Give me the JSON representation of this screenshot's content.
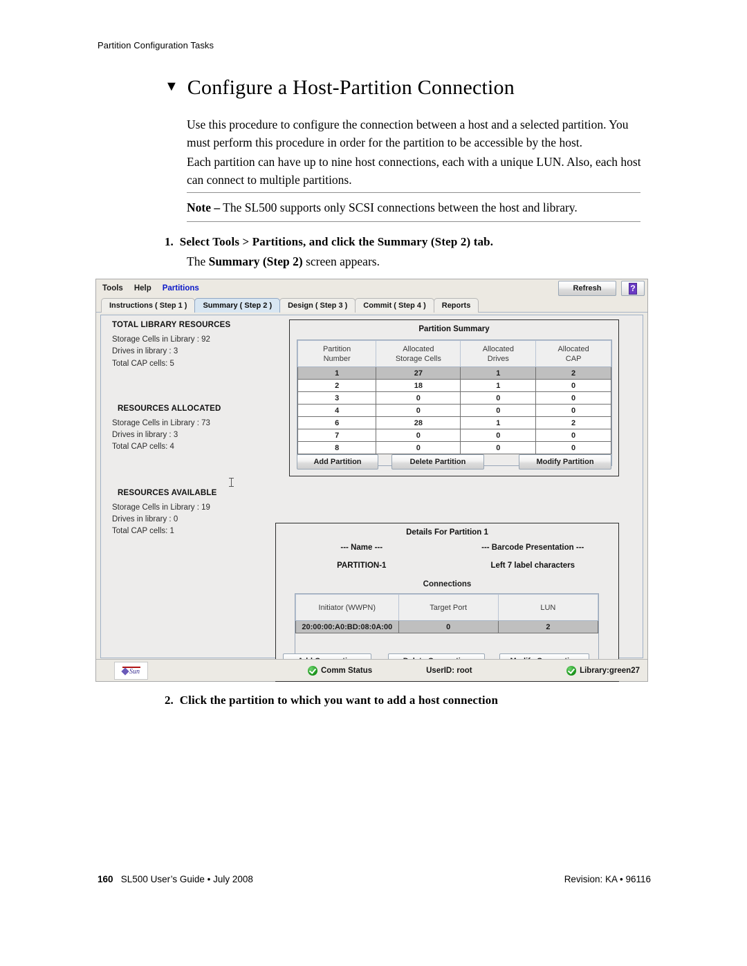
{
  "page": {
    "running_head": "Partition Configuration Tasks",
    "heading": "Configure a Host-Partition Connection",
    "heading_marker": "▼",
    "paragraph_1": "Use this procedure to configure the connection between a host and a selected partition. You must perform this procedure in order for the partition to be accessible by the host.",
    "paragraph_2": "Each partition can have up to nine host connections, each with a unique LUN. Also, each host can connect to multiple partitions.",
    "note_label": "Note –",
    "note_text": "The SL500 supports only SCSI connections between the host and library.",
    "step_1_number": "1.",
    "step_1_text": "Select Tools > Partitions, and click the Summary (Step 2) tab.",
    "step_1_sub_prefix": "The ",
    "step_1_sub_bold": "Summary (Step 2)",
    "step_1_sub_suffix": " screen appears.",
    "step_2_number": "2.",
    "step_2_text": "Click the partition to which you want to add a host connection",
    "footer_page": "160",
    "footer_left": "SL500 User’s Guide • July 2008",
    "footer_right": "Revision: KA • 96116"
  },
  "app": {
    "menubar": {
      "items": [
        {
          "label": "Tools",
          "active": false
        },
        {
          "label": "Help",
          "active": false
        },
        {
          "label": "Partitions",
          "active": true
        }
      ],
      "refresh_label": "Refresh",
      "help_label": "?"
    },
    "tabs": [
      {
        "label": "Instructions ( Step 1 )",
        "selected": false
      },
      {
        "label": "Summary ( Step 2 )",
        "selected": true
      },
      {
        "label": "Design ( Step 3 )",
        "selected": false
      },
      {
        "label": "Commit ( Step 4 )",
        "selected": false
      },
      {
        "label": "Reports",
        "selected": false
      }
    ],
    "resources": [
      {
        "heading": "TOTAL LIBRARY RESOURCES",
        "lines": [
          "Storage Cells in Library : 92",
          "Drives in library : 3",
          "Total CAP cells: 5"
        ]
      },
      {
        "heading": "RESOURCES ALLOCATED",
        "lines": [
          "Storage Cells in Library : 73",
          "Drives in library : 3",
          "Total CAP cells: 4"
        ]
      },
      {
        "heading": "RESOURCES AVAILABLE",
        "lines": [
          "Storage Cells in Library : 19",
          "Drives in library : 0",
          "Total CAP cells: 1"
        ]
      }
    ],
    "summary": {
      "title": "Partition Summary",
      "columns": [
        "Partition\nNumber",
        "Allocated\nStorage Cells",
        "Allocated\nDrives",
        "Allocated\nCAP"
      ],
      "rows": [
        {
          "cells": [
            "1",
            "27",
            "1",
            "2"
          ],
          "selected": true
        },
        {
          "cells": [
            "2",
            "18",
            "1",
            "0"
          ],
          "selected": false
        },
        {
          "cells": [
            "3",
            "0",
            "0",
            "0"
          ],
          "selected": false
        },
        {
          "cells": [
            "4",
            "0",
            "0",
            "0"
          ],
          "selected": false
        },
        {
          "cells": [
            "6",
            "28",
            "1",
            "2"
          ],
          "selected": false
        },
        {
          "cells": [
            "7",
            "0",
            "0",
            "0"
          ],
          "selected": false
        },
        {
          "cells": [
            "8",
            "0",
            "0",
            "0"
          ],
          "selected": false
        }
      ],
      "buttons": {
        "add": "Add Partition",
        "delete": "Delete Partition",
        "modify": "Modify Partition"
      }
    },
    "details": {
      "title": "Details For Partition 1",
      "name_label": "--- Name ---",
      "name_value": "PARTITION-1",
      "barcode_label": "--- Barcode Presentation ---",
      "barcode_value": "Left 7 label characters",
      "connections_title": "Connections",
      "connections_columns": [
        "Initiator (WWPN)",
        "Target Port",
        "LUN"
      ],
      "connections_rows": [
        {
          "cells": [
            "20:00:00:A0:BD:08:0A:00",
            "0",
            "2"
          ],
          "selected": true
        }
      ],
      "buttons": {
        "add": "Add Connection",
        "delete": "Delete Connection",
        "modify": "Modify Connection"
      }
    },
    "statusbar": {
      "logo_text": "Sun",
      "comm_status": "Comm Status",
      "user_id": "UserID: root",
      "library": "Library:green27"
    }
  },
  "colors": {
    "accent_menu": "#0a18c8",
    "tab_selected_bg": "#d8e6f2",
    "row_selected_bg": "#bfbfbf",
    "help_badge": "#6a3bc4",
    "status_ok": "#1f9a1f"
  }
}
